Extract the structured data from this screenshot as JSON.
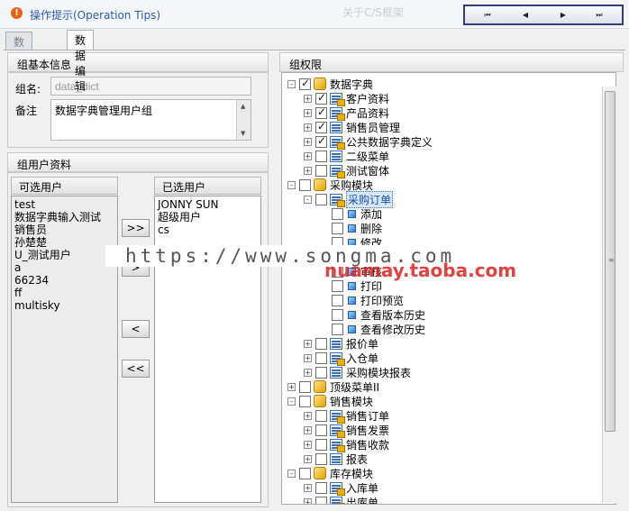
{
  "header": {
    "tip_icon": "!",
    "tip_text": "操作提示(Operation Tips)",
    "faded_title": "关于C/S框架",
    "nav_buttons": [
      "⏮",
      "◀",
      "▶",
      "⏭"
    ]
  },
  "tabs": [
    {
      "label": "数据查询",
      "active": false
    },
    {
      "label": "数据编辑",
      "active": true
    }
  ],
  "group_info": {
    "title": "组基本信息",
    "name_label": "组名:",
    "name_value": "data_dict",
    "remark_label": "备注",
    "remark_value": "数据字典管理用户组"
  },
  "group_users": {
    "title": "组用户资料",
    "available_header": "可选用户",
    "available": [
      "test",
      "数据字典输入测试",
      "销售员",
      "孙楚楚",
      "U_测试用户",
      "a",
      "66234",
      "ff",
      "multisky"
    ],
    "selected_header": "已选用户",
    "selected": [
      "JONNY SUN",
      "超级用户",
      "cs"
    ],
    "buttons": {
      "add_all": ">>",
      "add_one": ">",
      "remove_one": "<",
      "remove_all": "<<"
    }
  },
  "permissions": {
    "title": "组权限",
    "selected_node_color": "#d6e8ff",
    "tree": [
      {
        "label": "数据字典",
        "level": 0,
        "icon": "cube",
        "checked": true,
        "exp": "-"
      },
      {
        "label": "客户资料",
        "level": 1,
        "icon": "form-lock",
        "checked": true,
        "exp": "+"
      },
      {
        "label": "产品资料",
        "level": 1,
        "icon": "form-lock",
        "checked": true,
        "exp": "+"
      },
      {
        "label": "销售员管理",
        "level": 1,
        "icon": "form",
        "checked": true,
        "exp": "+"
      },
      {
        "label": "公共数据字典定义",
        "level": 1,
        "icon": "form-lock",
        "checked": true,
        "exp": "+"
      },
      {
        "label": "二级菜单",
        "level": 1,
        "icon": "form",
        "checked": false,
        "exp": "+"
      },
      {
        "label": "测试窗体",
        "level": 1,
        "icon": "form-lock",
        "checked": false,
        "exp": "+"
      },
      {
        "label": "采购模块",
        "level": 0,
        "icon": "cube",
        "checked": false,
        "exp": "-"
      },
      {
        "label": "采购订单",
        "level": 1,
        "icon": "form-lock",
        "checked": false,
        "exp": "-",
        "selected": true
      },
      {
        "label": "添加",
        "level": 2,
        "icon": "bullet",
        "checked": false,
        "exp": ""
      },
      {
        "label": "删除",
        "level": 2,
        "icon": "bullet",
        "checked": false,
        "exp": ""
      },
      {
        "label": "修改",
        "level": 2,
        "icon": "bullet",
        "checked": false,
        "exp": ""
      },
      {
        "label": "",
        "level": 2,
        "icon": "bullet",
        "checked": false,
        "exp": ""
      },
      {
        "label": "审核",
        "level": 2,
        "icon": "bullet",
        "checked": false,
        "exp": ""
      },
      {
        "label": "打印",
        "level": 2,
        "icon": "bullet",
        "checked": false,
        "exp": ""
      },
      {
        "label": "打印预览",
        "level": 2,
        "icon": "bullet",
        "checked": false,
        "exp": ""
      },
      {
        "label": "查看版本历史",
        "level": 2,
        "icon": "bullet",
        "checked": false,
        "exp": ""
      },
      {
        "label": "查看修改历史",
        "level": 2,
        "icon": "bullet",
        "checked": false,
        "exp": ""
      },
      {
        "label": "报价单",
        "level": 1,
        "icon": "form",
        "checked": false,
        "exp": "+"
      },
      {
        "label": "入仓单",
        "level": 1,
        "icon": "form-lock",
        "checked": false,
        "exp": "+"
      },
      {
        "label": "采购模块报表",
        "level": 1,
        "icon": "form",
        "checked": false,
        "exp": "+"
      },
      {
        "label": "顶级菜单II",
        "level": 0,
        "icon": "cube",
        "checked": false,
        "exp": "+"
      },
      {
        "label": "销售模块",
        "level": 0,
        "icon": "cube",
        "checked": false,
        "exp": "-"
      },
      {
        "label": "销售订单",
        "level": 1,
        "icon": "form-lock",
        "checked": false,
        "exp": "+"
      },
      {
        "label": "销售发票",
        "level": 1,
        "icon": "form-lock",
        "checked": false,
        "exp": "+"
      },
      {
        "label": "销售收款",
        "level": 1,
        "icon": "form-lock",
        "checked": false,
        "exp": "+"
      },
      {
        "label": "报表",
        "level": 1,
        "icon": "form",
        "checked": false,
        "exp": "+"
      },
      {
        "label": "库存模块",
        "level": 0,
        "icon": "cube",
        "checked": false,
        "exp": "-"
      },
      {
        "label": "入库单",
        "level": 1,
        "icon": "form-lock",
        "checked": false,
        "exp": "+"
      },
      {
        "label": "出库单",
        "level": 1,
        "icon": "form-lock",
        "checked": false,
        "exp": "+"
      }
    ]
  },
  "overlays": {
    "url_text": "https://www.songma.com",
    "shop_text": "nuamay.taoba.com"
  }
}
